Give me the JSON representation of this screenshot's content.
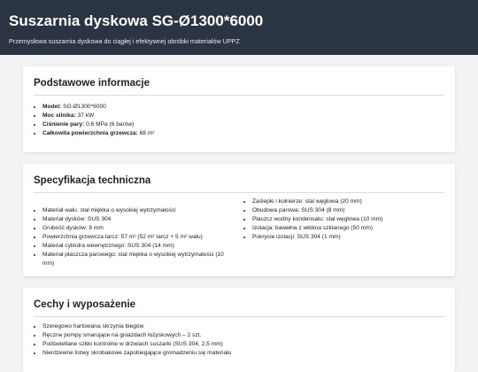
{
  "header": {
    "title": "Suszarnia dyskowa SG-Ø1300*6000",
    "subtitle": "Przemysłowa suszarnia dyskowa do ciągłej i efektywnej obróbki materiałów UPPZ"
  },
  "basic": {
    "heading": "Podstawowe informacje",
    "items": [
      {
        "label": "Model:",
        "value": " SG-Ø1300*6000"
      },
      {
        "label": "Moc silnika:",
        "value": " 37 kW"
      },
      {
        "label": "Ciśnienie pary:",
        "value": " 0,6 MPa (6 barów)"
      },
      {
        "label": "Całkowita powierzchnia grzewcza:",
        "value": " 68 m²"
      }
    ]
  },
  "spec": {
    "heading": "Specyfikacja techniczna",
    "left": [
      "Materiał wału: stal miękka o wysokiej wytrzymałości",
      "Materiał dysków: SUS 304",
      "Grubość dysków: 8 mm",
      "Powierzchnia grzewcza tarcz: 57 m² (52 m² tarcz + 5 m² wału)",
      "Materiał cylindra wewnętrznego: SUS 304 (14 mm)",
      "Materiał płaszcza parowego: stal miękka o wysokiej wytrzymałości (10 mm)"
    ],
    "right": [
      "Zaślepki i kołnierze: stal węglowa (20 mm)",
      "Obudowa parowa: SUS 304 (8 mm)",
      "Płaszcz wodny kondensatu: stal węglowa (10 mm)",
      "Izolacja: bawełna z włókna szklanego (50 mm)",
      "Pokrycie izolacji: SUS 304 (1 mm)"
    ]
  },
  "features": {
    "heading": "Cechy i wyposażenie",
    "items": [
      "Szeregowo hartowana skrzynia biegów",
      "Ręczne pompy smarujące na gniazdach łożyskowych – 2 szt.",
      "Podświetlane szkło kontrolne w drzwiach suszarki (SUS 304, 2,5 mm)",
      "Nierdzewne listwy skrobakowe zapobiegające gromadzeniu się materiału"
    ]
  }
}
